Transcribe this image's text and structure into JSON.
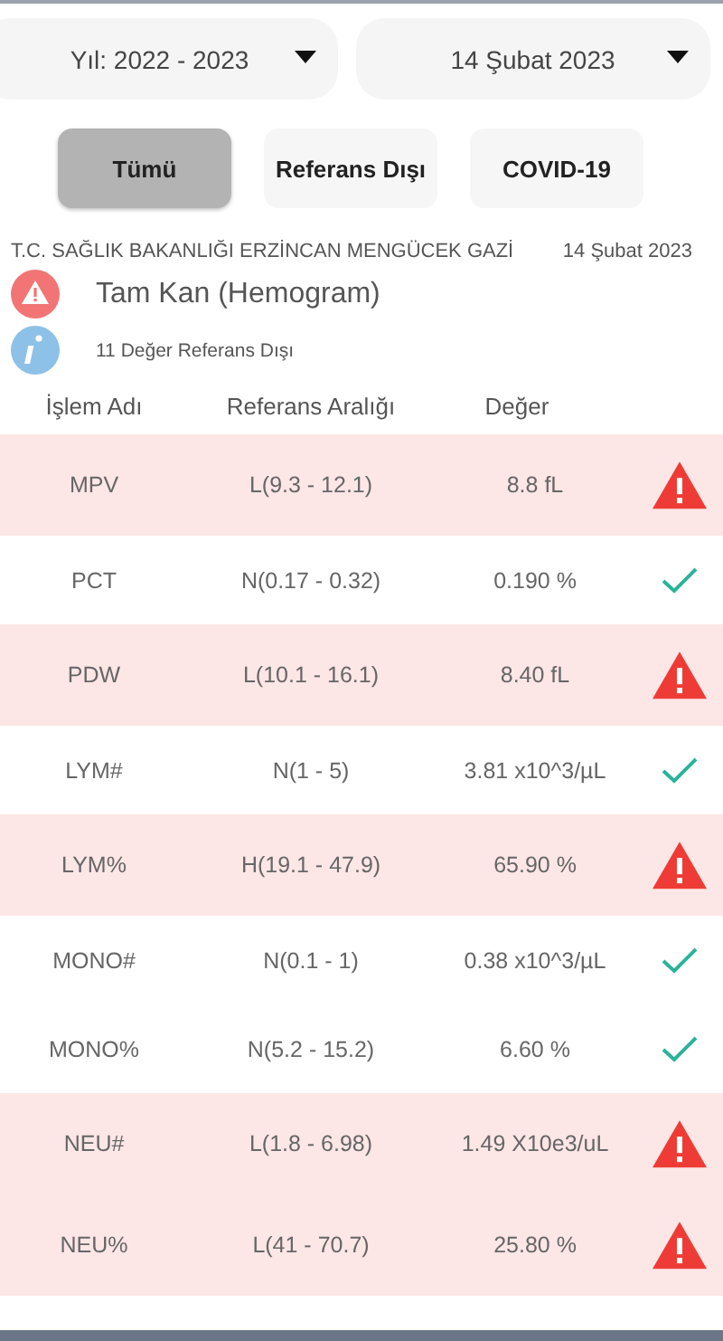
{
  "filters": [
    {
      "label": "Yıl: 2022 - 2023"
    },
    {
      "label": "14 Şubat 2023"
    }
  ],
  "tabs": [
    {
      "label": "Tümü",
      "selected": true
    },
    {
      "label": "Referans Dışı",
      "selected": false
    },
    {
      "label": "COVID-19",
      "selected": false
    }
  ],
  "report": {
    "institution": "T.C. SAĞLIK BAKANLIĞI ERZİNCAN MENGÜCEK GAZİ",
    "date": "14 Şubat 2023",
    "title": "Tam Kan (Hemogram)",
    "info": "11 Değer Referans Dışı"
  },
  "table": {
    "columns": [
      "İşlem Adı",
      "Referans Aralığı",
      "Değer"
    ],
    "rows": [
      {
        "name": "MPV",
        "range": "L(9.3 - 12.1)",
        "value": "8.8 fL",
        "out_of_range": true
      },
      {
        "name": "PCT",
        "range": "N(0.17 - 0.32)",
        "value": "0.190 %",
        "out_of_range": false
      },
      {
        "name": "PDW",
        "range": "L(10.1 - 16.1)",
        "value": "8.40 fL",
        "out_of_range": true
      },
      {
        "name": "LYM#",
        "range": "N(1 - 5)",
        "value": "3.81 x10^3/µL",
        "out_of_range": false
      },
      {
        "name": "LYM%",
        "range": "H(19.1 - 47.9)",
        "value": "65.90 %",
        "out_of_range": true
      },
      {
        "name": "MONO#",
        "range": "N(0.1 - 1)",
        "value": "0.38 x10^3/µL",
        "out_of_range": false
      },
      {
        "name": "MONO%",
        "range": "N(5.2 - 15.2)",
        "value": "6.60 %",
        "out_of_range": false
      },
      {
        "name": "NEU#",
        "range": "L(1.8 - 6.98)",
        "value": "1.49 X10e3/uL",
        "out_of_range": true
      },
      {
        "name": "NEU%",
        "range": "L(41 - 70.7)",
        "value": "25.80 %",
        "out_of_range": true
      }
    ]
  }
}
